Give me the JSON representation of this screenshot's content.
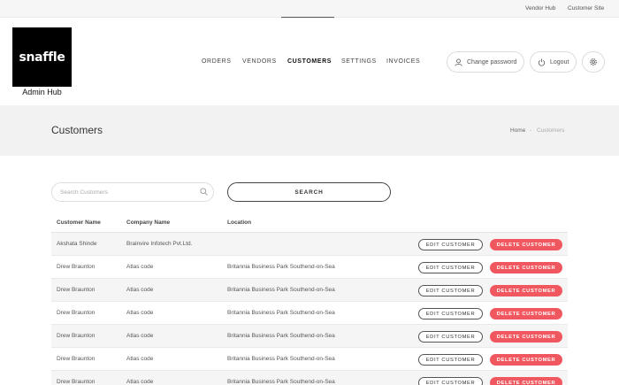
{
  "topbar": {
    "vendor_hub": "Vendor Hub",
    "customer_site": "Customer Site"
  },
  "logo": {
    "brand": "snaffle",
    "subtitle": "Admin Hub"
  },
  "nav": [
    "ORDERS",
    "VENDORS",
    "CUSTOMERS",
    "SETTINGS",
    "INVOICES"
  ],
  "nav_active": "CUSTOMERS",
  "account": {
    "change_password": "Change password",
    "logout": "Logout"
  },
  "page": {
    "title": "Customers"
  },
  "breadcrumb": {
    "home": "Home",
    "separator": "-",
    "current": "Customers"
  },
  "search": {
    "placeholder": "Search Customers",
    "value": "",
    "button": "SEARCH"
  },
  "table": {
    "headers": [
      "Customer Name",
      "Company Name",
      "Location"
    ],
    "edit_label": "EDIT CUSTOMER",
    "delete_label": "DELETE CUSTOMER",
    "rows": [
      [
        "Akshata Shinde",
        "Brainvire Infotech Pvt.Ltd.",
        ""
      ],
      [
        "Drew Braunton",
        "Atlas code",
        "Britannia Business Park Southend-on-Sea"
      ],
      [
        "Drew Braunton",
        "Atlas code",
        "Britannia Business Park Southend-on-Sea"
      ],
      [
        "Drew Braunton",
        "Atlas code",
        "Britannia Business Park Southend-on-Sea"
      ],
      [
        "Drew Braunton",
        "Atlas code",
        "Britannia Business Park Southend-on-Sea"
      ],
      [
        "Drew Braunton",
        "Atlas code",
        "Britannia Business Park Southend-on-Sea"
      ],
      [
        "Drew Braunton",
        "Atlas code",
        "Britannia Business Park Southend-on-Sea"
      ]
    ]
  },
  "colors": {
    "delete": "#f0575e",
    "titlebar_bg": "#f2f2f2",
    "logo_bg": "#000000"
  },
  "icons": {
    "search": "search-icon",
    "user": "user-icon",
    "logout": "power-icon",
    "settings": "gear-icon"
  }
}
